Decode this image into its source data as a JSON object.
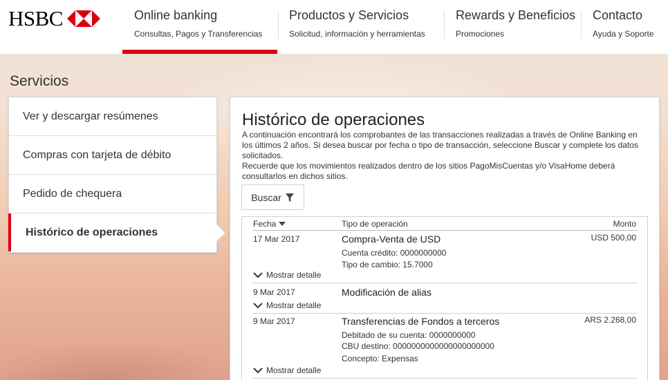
{
  "brand": {
    "name": "HSBC",
    "red": "#db0011"
  },
  "nav": [
    {
      "title": "Online banking",
      "sub": "Consultas, Pagos y Transferencias",
      "active": true
    },
    {
      "title": "Productos y Servicios",
      "sub": "Solicitud, información y herramientas"
    },
    {
      "title": "Rewards y Beneficios",
      "sub": "Promociones"
    },
    {
      "title": "Contacto",
      "sub": "Ayuda y Soporte"
    }
  ],
  "section_title": "Servicios",
  "sidebar": {
    "items": [
      {
        "label": "Ver y descargar resúmenes"
      },
      {
        "label": "Compras con tarjeta de débito"
      },
      {
        "label": "Pedido de chequera"
      },
      {
        "label": "Histórico de operaciones",
        "active": true
      }
    ]
  },
  "main": {
    "title": "Histórico de operaciones",
    "desc1": "A continuación encontrará los comprobantes de las transacciones realizadas a través de Online Banking en los últimos 2 años. Si desea buscar por fecha o tipo de transacción, seleccione Buscar y complete los datos solicitados.",
    "desc2": "Recuerde que los movimientos realizados dentro de los sitios PagoMisCuentas y/o VisaHome deberá consultarlos en dichos sitios.",
    "search_label": "Buscar",
    "search_icon": "filter-icon",
    "table": {
      "col_date": "Fecha",
      "col_type": "Tipo de operación",
      "col_amount": "Monto",
      "show_detail": "Mostrar detalle",
      "rows": [
        {
          "date": "17 Mar 2017",
          "title": "Compra-Venta de USD",
          "amount": "USD 500,00",
          "details": [
            "Cuenta crédito: 0000000000",
            "Tipo de cambio: 15.7000"
          ]
        },
        {
          "date": "9 Mar 2017",
          "title": "Modificación de alias",
          "amount": "",
          "details": []
        },
        {
          "date": "9 Mar 2017",
          "title": "Transferencias de Fondos a terceros",
          "amount": "ARS 2.268,00",
          "details": [
            "Debitado de su cuenta: 0000000000",
            "CBU destino: 0000000000000000000000",
            "Concepto: Expensas"
          ]
        }
      ]
    }
  }
}
